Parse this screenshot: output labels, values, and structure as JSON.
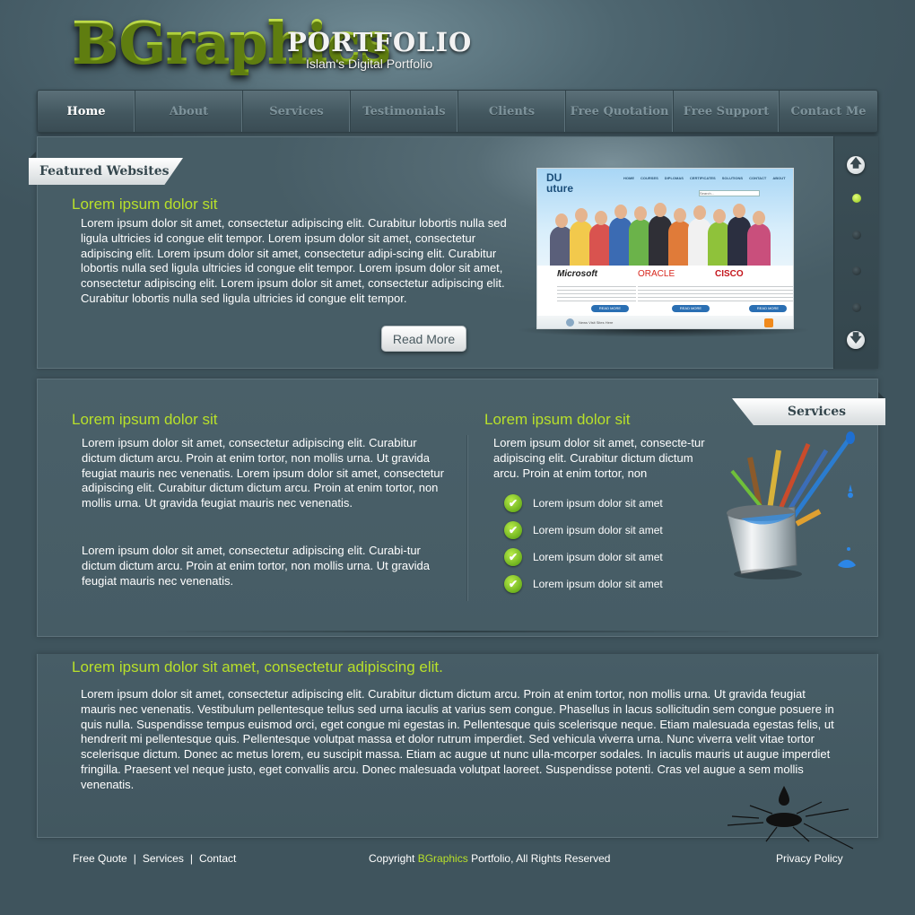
{
  "header": {
    "logo_main": "BGraphics",
    "logo_secondary": "PORTFOLIO",
    "tagline": "Islam's Digital Portfolio"
  },
  "nav": {
    "items": [
      {
        "label": "Home",
        "active": true
      },
      {
        "label": "About"
      },
      {
        "label": "Services"
      },
      {
        "label": "Testimonials"
      },
      {
        "label": "Clients"
      },
      {
        "label": "Free Quotation"
      },
      {
        "label": "Free Support"
      },
      {
        "label": "Contact Me"
      }
    ]
  },
  "featured": {
    "ribbon": "Featured Websites",
    "heading": "Lorem ipsum dolor sit",
    "body": "Lorem ipsum dolor sit amet, consectetur adipiscing elit. Curabitur lobortis nulla sed ligula ultricies id congue elit tempor. Lorem ipsum dolor sit amet, consectetur adipiscing elit. Lorem ipsum dolor sit amet, consectetur adipi-scing elit. Curabitur lobortis nulla sed ligula ultricies id congue elit tempor. Lorem ipsum dolor sit amet, consectetur adipiscing elit. Lorem ipsum dolor sit amet, consectetur adipiscing elit. Curabitur lobortis nulla sed ligula ultricies id congue elit tempor.",
    "read_more": "Read More",
    "preview": {
      "logo_line1": "DU",
      "logo_line2": "uture",
      "nav": [
        "HOME",
        "COURSES",
        "DIPLOMAS",
        "CERTIFICATES",
        "SOLUTIONS",
        "CONTACT",
        "ABOUT"
      ],
      "search_placeholder": "Search...",
      "brands": [
        "Microsoft",
        "ORACLE",
        "CISCO"
      ],
      "button": "READ MORE",
      "footer_text": "News Visit Sites Here"
    },
    "scroller": {
      "up_icon": "arrow-up-icon",
      "down_icon": "arrow-down-icon",
      "active_index": 0,
      "dot_count": 4
    }
  },
  "middle": {
    "left_heading": "Lorem ipsum dolor sit",
    "left_para1": "Lorem ipsum dolor sit amet, consectetur adipiscing elit. Curabitur dictum dictum arcu. Proin at enim tortor, non mollis urna. Ut gravida feugiat mauris nec venenatis.  Lorem ipsum dolor sit amet, consectetur adipiscing elit. Curabitur dictum dictum arcu. Proin at enim tortor, non mollis urna. Ut gravida feugiat mauris nec venenatis.",
    "left_para2": "Lorem ipsum dolor sit amet, consectetur adipiscing elit. Curabi-tur dictum dictum arcu. Proin at enim tortor, non mollis urna. Ut gravida feugiat mauris nec venenatis.",
    "right_heading": "Lorem ipsum dolor sit",
    "right_para": "Lorem ipsum dolor sit amet, consecte-tur adipiscing elit. Curabitur dictum dictum arcu. Proin at enim tortor, non",
    "services_ribbon": "Services",
    "checklist": [
      "Lorem ipsum dolor sit amet",
      "Lorem ipsum dolor sit amet",
      "Lorem ipsum dolor sit amet",
      "Lorem ipsum dolor sit amet"
    ]
  },
  "bottom": {
    "heading": "Lorem ipsum dolor sit amet, consectetur adipiscing elit.",
    "body": "Lorem ipsum dolor sit amet, consectetur adipiscing elit. Curabitur dictum dictum arcu. Proin at enim tortor, non mollis urna. Ut gravida feugiat mauris nec venenatis. Vestibulum pellentesque tellus sed urna iaculis at varius sem congue. Phasellus in lacus sollicitudin sem congue posuere in quis nulla. Suspendisse tempus euismod orci, eget congue mi egestas in. Pellentesque quis scelerisque neque. Etiam malesuada egestas felis, ut hendrerit mi pellentesque quis. Pellentesque volutpat massa et dolor rutrum imperdiet. Sed vehicula viverra urna. Nunc viverra velit vitae tortor scelerisque dictum. Donec ac metus lorem, eu suscipit massa. Etiam ac augue ut nunc ulla-mcorper sodales. In iaculis mauris ut augue imperdiet fringilla. Praesent vel neque justo, eget convallis arcu. Donec malesuada volutpat laoreet. Suspendisse potenti. Cras vel augue a sem mollis venenatis."
  },
  "footer": {
    "links": [
      "Free Quote",
      "Services",
      "Contact"
    ],
    "separator": "|",
    "copyright_prefix": "Copyright ",
    "copyright_brand": "BGraphics",
    "copyright_suffix": " Portfolio, All Rights Reserved",
    "privacy": "Privacy Policy"
  },
  "colors": {
    "accent_green": "#b8e02a",
    "background": "#425861",
    "ribbon": "#ffffff"
  }
}
